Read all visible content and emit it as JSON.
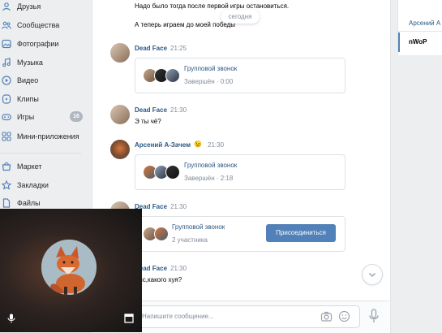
{
  "sidebar": {
    "items": [
      {
        "label": "Друзья",
        "icon": "friends-icon"
      },
      {
        "label": "Сообщества",
        "icon": "communities-icon"
      },
      {
        "label": "Фотографии",
        "icon": "photos-icon"
      },
      {
        "label": "Музыка",
        "icon": "music-icon"
      },
      {
        "label": "Видео",
        "icon": "video-icon"
      },
      {
        "label": "Клипы",
        "icon": "clips-icon"
      },
      {
        "label": "Игры",
        "icon": "games-icon",
        "badge": "16"
      },
      {
        "label": "Мини-приложения",
        "icon": "mini-apps-icon"
      },
      {
        "label": "Маркет",
        "icon": "market-icon"
      },
      {
        "label": "Закладки",
        "icon": "bookmarks-icon"
      },
      {
        "label": "Файлы",
        "icon": "files-icon"
      }
    ]
  },
  "chat": {
    "top_lines": [
      "Надо было тогда после первой игры остановиться.",
      "А теперь играем до моей победы"
    ],
    "date_separator": "сегодня",
    "messages": [
      {
        "author": "Dead Face",
        "time": "21:25",
        "call": {
          "title": "Групповой звонок",
          "status": "Завершён · 0:00"
        }
      },
      {
        "author": "Dead Face",
        "time": "21:30",
        "text": "Э ты чё?"
      },
      {
        "author": "Арсений А-Зачем",
        "emoji": "😉",
        "time": "21:30",
        "call": {
          "title": "Групповой звонок",
          "status": "Завершён · 2:18"
        }
      },
      {
        "author": "Dead Face",
        "time": "21:30",
        "call": {
          "title": "Групповой звонок",
          "status": "2 участника",
          "action": "Присоединиться"
        }
      },
      {
        "author": "Dead Face",
        "time": "21:30",
        "text": "Бис,какого хуя?"
      }
    ],
    "input_placeholder": "Напишите сообщение..."
  },
  "right_panel": {
    "items": [
      "Арсений А",
      "nWoP"
    ]
  },
  "colors": {
    "link": "#2a5885",
    "accent": "#5181b8",
    "muted": "#818c99",
    "page_bg": "#edeef0"
  },
  "icons": [
    "chevron-down-icon",
    "camera-icon",
    "smile-icon",
    "microphone-icon",
    "fullscreen-icon"
  ]
}
